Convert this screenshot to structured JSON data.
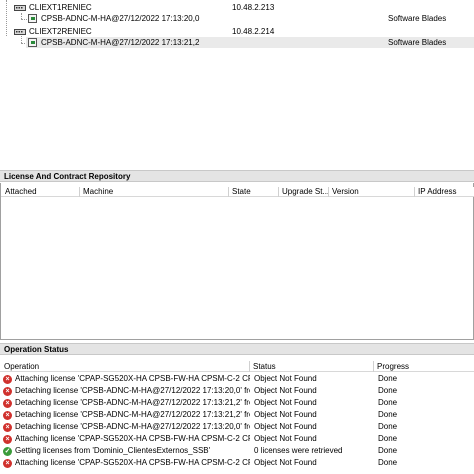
{
  "tree": {
    "rows": [
      {
        "name": "CLIEXT1RENIEC",
        "ip": "10.48.2.213",
        "product": ""
      },
      {
        "name": "CPSB-ADNC-M-HA@27/12/2022 17:13:20,0",
        "ip": "",
        "product": "Software Blades"
      },
      {
        "name": "CLIEXT2RENIEC",
        "ip": "10.48.2.214",
        "product": ""
      },
      {
        "name": "CPSB-ADNC-M-HA@27/12/2022 17:13:21,2",
        "ip": "",
        "product": "Software Blades"
      }
    ]
  },
  "license_panel": {
    "title": "License And Contract Repository",
    "columns": [
      "Attached",
      "Machine",
      "State",
      "Upgrade St...",
      "Version",
      "IP Address"
    ]
  },
  "operation_panel": {
    "title": "Operation Status",
    "columns": [
      "Operation",
      "Status",
      "Progress"
    ],
    "rows": [
      {
        "icon": "error",
        "operation": "Attaching license 'CPAP-SG520X-HA CPSB-FW-HA CPSM-C-2 CPSB-...",
        "status": "Object Not Found",
        "progress": "Done"
      },
      {
        "icon": "error",
        "operation": "Detaching license 'CPSB-ADNC-M-HA@27/12/2022 17:13:20,0' from '...",
        "status": "Object Not Found",
        "progress": "Done"
      },
      {
        "icon": "error",
        "operation": "Detaching license 'CPSB-ADNC-M-HA@27/12/2022 17:13:21,2' from '...",
        "status": "Object Not Found",
        "progress": "Done"
      },
      {
        "icon": "error",
        "operation": "Detaching license 'CPSB-ADNC-M-HA@27/12/2022 17:13:21,2' from '...",
        "status": "Object Not Found",
        "progress": "Done"
      },
      {
        "icon": "error",
        "operation": "Detaching license 'CPSB-ADNC-M-HA@27/12/2022 17:13:20,0' from '...",
        "status": "Object Not Found",
        "progress": "Done"
      },
      {
        "icon": "error",
        "operation": "Attaching license 'CPAP-SG520X-HA CPSB-FW-HA CPSM-C-2 CPSB-...",
        "status": "Object Not Found",
        "progress": "Done"
      },
      {
        "icon": "success",
        "operation": "Getting licenses from 'Dominio_ClientesExternos_SSB'",
        "status": "0 licenses were retrieved",
        "progress": "Done"
      },
      {
        "icon": "error",
        "operation": "Attaching license 'CPAP-SG520X-HA CPSB-FW-HA CPSM-C-2 CPSB-...",
        "status": "Object Not Found",
        "progress": "Done"
      }
    ]
  }
}
